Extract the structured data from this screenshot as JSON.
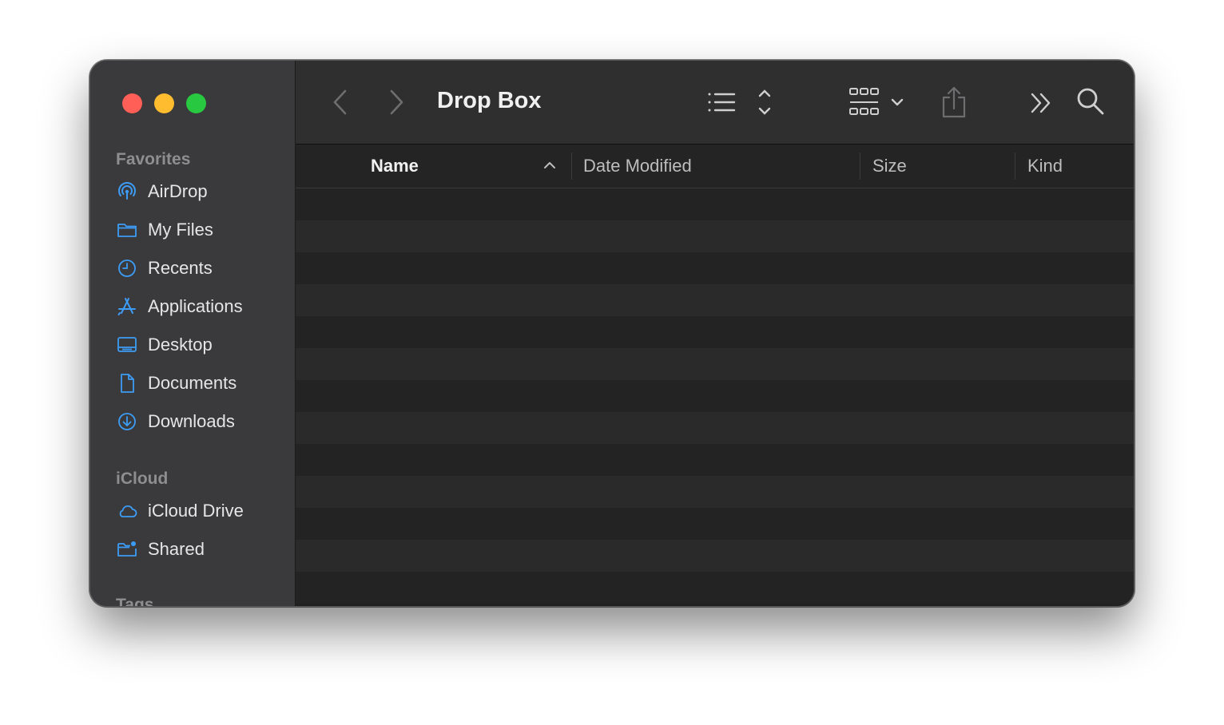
{
  "window": {
    "title": "Drop Box"
  },
  "sidebar": {
    "sections": [
      {
        "title": "Favorites"
      },
      {
        "title": "iCloud"
      },
      {
        "title": "Tags"
      }
    ],
    "favorites": [
      {
        "label": "AirDrop",
        "icon": "airdrop-icon"
      },
      {
        "label": "My Files",
        "icon": "folder-icon"
      },
      {
        "label": "Recents",
        "icon": "clock-icon"
      },
      {
        "label": "Applications",
        "icon": "applications-icon"
      },
      {
        "label": "Desktop",
        "icon": "desktop-icon"
      },
      {
        "label": "Documents",
        "icon": "document-icon"
      },
      {
        "label": "Downloads",
        "icon": "download-icon"
      }
    ],
    "icloud": [
      {
        "label": "iCloud Drive",
        "icon": "cloud-icon"
      },
      {
        "label": "Shared",
        "icon": "shared-folder-icon"
      }
    ]
  },
  "columns": {
    "name": "Name",
    "date_modified": "Date Modified",
    "size": "Size",
    "kind": "Kind"
  },
  "colors": {
    "accent": "#3d9cf5",
    "close": "#ff5f57",
    "minimize": "#febc2e",
    "zoom": "#28c840"
  }
}
